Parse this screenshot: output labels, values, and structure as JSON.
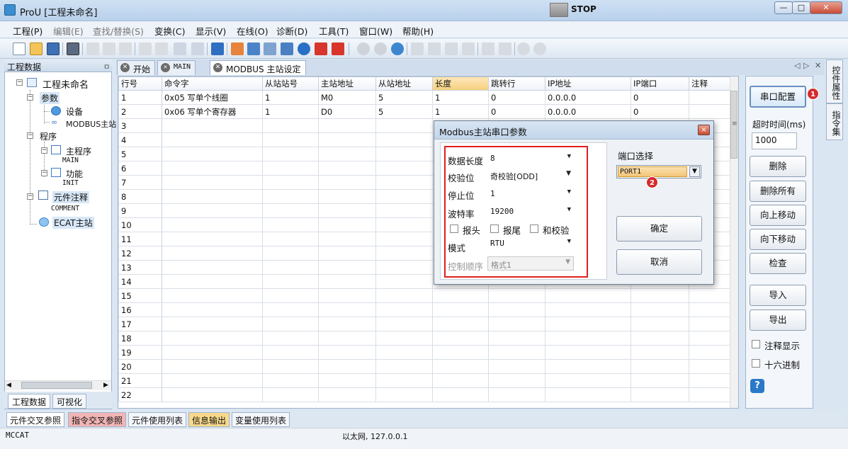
{
  "window": {
    "title": "ProU [工程未命名]",
    "minimize": "—",
    "maximize": "□",
    "close": "✕"
  },
  "menu": [
    "工程(P)",
    "编辑(E)",
    "查找/替换(S)",
    "变换(C)",
    "显示(V)",
    "在线(O)",
    "诊断(D)",
    "工具(T)",
    "窗口(W)",
    "帮助(H)"
  ],
  "toolbar": {
    "stop_label": "STOP"
  },
  "left_panel": {
    "title": "工程数据",
    "pin": "📌",
    "tree": {
      "root": "工程未命名",
      "params": "参数",
      "device": "设备",
      "modbus_master": "MODBUS主站",
      "program": "程序",
      "main_program": "主程序",
      "main": "MAIN",
      "function": "功能",
      "init": "INIT",
      "element_comment": "元件注释",
      "comment": "COMMENT",
      "ecat_master": "ECAT主站"
    },
    "tabs": [
      "工程数据",
      "可视化"
    ]
  },
  "doc_tabs": [
    {
      "label": "开始"
    },
    {
      "label": "MAIN"
    },
    {
      "label": "MODBUS 主站设定"
    }
  ],
  "grid": {
    "columns": [
      "行号",
      "命令字",
      "从站站号",
      "主站地址",
      "从站地址",
      "长度",
      "跳转行",
      "IP地址",
      "IP端口",
      "注释"
    ],
    "rows": [
      [
        "1",
        "0x05 写单个线圈",
        "1",
        "M0",
        "5",
        "1",
        "0",
        "0.0.0.0",
        "0",
        ""
      ],
      [
        "2",
        "0x06 写单个寄存器",
        "1",
        "D0",
        "5",
        "1",
        "0",
        "0.0.0.0",
        "0",
        ""
      ],
      [
        "3",
        "",
        "",
        "",
        "",
        "",
        "",
        "",
        "",
        ""
      ],
      [
        "4",
        "",
        "",
        "",
        "",
        "",
        "",
        "",
        "",
        ""
      ],
      [
        "5",
        "",
        "",
        "",
        "",
        "",
        "",
        "",
        "",
        ""
      ],
      [
        "6",
        "",
        "",
        "",
        "",
        "",
        "",
        "",
        "",
        ""
      ],
      [
        "7",
        "",
        "",
        "",
        "",
        "",
        "",
        "",
        "",
        ""
      ],
      [
        "8",
        "",
        "",
        "",
        "",
        "",
        "",
        "",
        "",
        ""
      ],
      [
        "9",
        "",
        "",
        "",
        "",
        "",
        "",
        "",
        "",
        ""
      ],
      [
        "10",
        "",
        "",
        "",
        "",
        "",
        "",
        "",
        "",
        ""
      ],
      [
        "11",
        "",
        "",
        "",
        "",
        "",
        "",
        "",
        "",
        ""
      ],
      [
        "12",
        "",
        "",
        "",
        "",
        "",
        "",
        "",
        "",
        ""
      ],
      [
        "13",
        "",
        "",
        "",
        "",
        "",
        "",
        "",
        "",
        ""
      ],
      [
        "14",
        "",
        "",
        "",
        "",
        "",
        "",
        "",
        "",
        ""
      ],
      [
        "15",
        "",
        "",
        "",
        "",
        "",
        "",
        "",
        "",
        ""
      ],
      [
        "16",
        "",
        "",
        "",
        "",
        "",
        "",
        "",
        "",
        ""
      ],
      [
        "17",
        "",
        "",
        "",
        "",
        "",
        "",
        "",
        "",
        ""
      ],
      [
        "18",
        "",
        "",
        "",
        "",
        "",
        "",
        "",
        "",
        ""
      ],
      [
        "19",
        "",
        "",
        "",
        "",
        "",
        "",
        "",
        "",
        ""
      ],
      [
        "20",
        "",
        "",
        "",
        "",
        "",
        "",
        "",
        "",
        ""
      ],
      [
        "21",
        "",
        "",
        "",
        "",
        "",
        "",
        "",
        "",
        ""
      ],
      [
        "22",
        "",
        "",
        "",
        "",
        "",
        "",
        "",
        "",
        ""
      ]
    ]
  },
  "right_panel": {
    "serial_config": "串口配置",
    "badge1": "1",
    "timeout_label": "超时时间(ms)",
    "timeout_value": "1000",
    "delete": "删除",
    "delete_all": "删除所有",
    "move_up": "向上移动",
    "move_down": "向下移动",
    "check": "检查",
    "import": "导入",
    "export": "导出",
    "show_comment": "注释显示",
    "hex": "十六进制",
    "help": "?"
  },
  "vertical_tabs": [
    "控件属性",
    "指令集"
  ],
  "bottom_tabs": [
    "元件交叉参照",
    "指令交叉参照",
    "元件使用列表",
    "信息输出",
    "变量使用列表"
  ],
  "status": {
    "left": "MCCAT",
    "center": "以太网, 127.0.0.1"
  },
  "dialog": {
    "title": "Modbus主站串口参数",
    "close": "×",
    "fields": {
      "data_length": {
        "label": "数据长度",
        "value": "8"
      },
      "parity": {
        "label": "校验位",
        "value": "奇校验[ODD]"
      },
      "stop_bit": {
        "label": "停止位",
        "value": "1"
      },
      "baud_rate": {
        "label": "波特率",
        "value": "19200"
      },
      "mode": {
        "label": "模式",
        "value": "RTU"
      },
      "control_order": {
        "label": "控制顺序",
        "value": "格式1"
      }
    },
    "checkboxes": [
      "报头",
      "报尾",
      "和校验"
    ],
    "port_label": "端口选择",
    "port_value": "PORT1",
    "badge2": "2",
    "ok": "确定",
    "cancel": "取消"
  }
}
